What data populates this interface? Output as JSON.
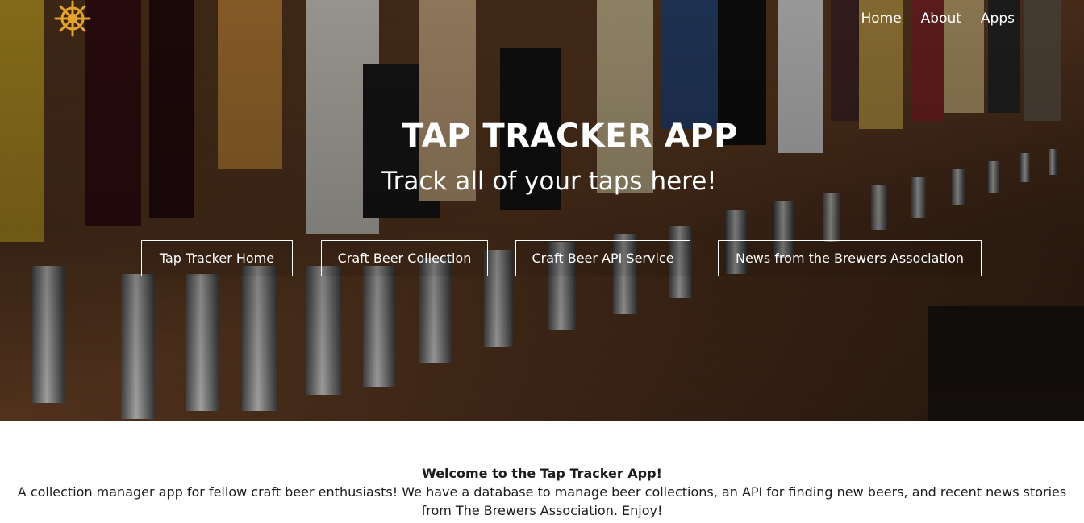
{
  "nav": {
    "logo_icon": "ship-wheel-icon",
    "logo_color": "#e3a22e",
    "links": [
      "Home",
      "About",
      "Apps"
    ]
  },
  "hero": {
    "title": "TAP TRACKER APP",
    "subtitle": "Track all of your taps here!",
    "buttons": [
      "Tap Tracker Home",
      "Craft Beer Collection",
      "Craft Beer API Service",
      "News from the Brewers Association"
    ]
  },
  "welcome": {
    "title": "Welcome to the Tap Tracker App!",
    "body": "A collection manager app for fellow craft beer enthusiasts! We have a database to manage beer collections, an API for finding new beers, and recent news stories from The Brewers Association. Enjoy!"
  }
}
